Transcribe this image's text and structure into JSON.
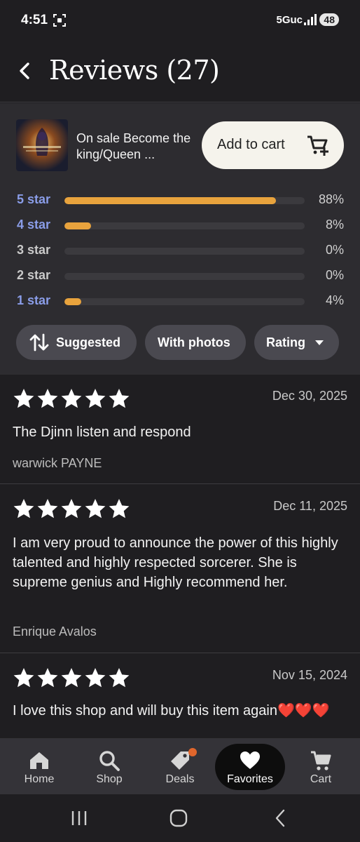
{
  "status": {
    "time": "4:51",
    "network": "5Guc",
    "battery": "48"
  },
  "header": {
    "title": "Reviews (27)",
    "back_icon": "chevron-left-icon"
  },
  "product": {
    "title": "On sale Become the king/Queen ...",
    "cart_button": "Add to cart",
    "cart_icon": "cart-plus-icon"
  },
  "ratings": [
    {
      "label": "5 star",
      "percent": "88%",
      "fraction": 0.88,
      "style": "link"
    },
    {
      "label": "4 star",
      "percent": "8%",
      "fraction": 0.11,
      "style": "link"
    },
    {
      "label": "3 star",
      "percent": "0%",
      "fraction": 0,
      "style": "plain"
    },
    {
      "label": "2 star",
      "percent": "0%",
      "fraction": 0,
      "style": "plain"
    },
    {
      "label": "1 star",
      "percent": "4%",
      "fraction": 0.07,
      "style": "link"
    }
  ],
  "filters": {
    "suggested": "Suggested",
    "with_photos": "With photos",
    "rating": "Rating"
  },
  "reviews": [
    {
      "stars": 5,
      "date": "Dec 30, 2025",
      "text": "The Djinn listen and respond",
      "author": "warwick PAYNE"
    },
    {
      "stars": 5,
      "date": "Dec 11, 2025",
      "text": "I am very proud to announce the power of this highly talented and highly respected sorcerer. She is supreme genius and Highly recommend her.",
      "author": "Enrique Avalos"
    },
    {
      "stars": 5,
      "date": "Nov 15, 2024",
      "text": "I love this shop and will buy this item again❤️❤️❤️",
      "author": ""
    }
  ],
  "nav": {
    "home": "Home",
    "shop": "Shop",
    "deals": "Deals",
    "favorites": "Favorites",
    "cart": "Cart"
  },
  "colors": {
    "background": "#1f1e21",
    "panel": "#2d2c30",
    "bar_fill": "#e8a33d",
    "link_label": "#8a9de8",
    "deals_badge": "#e0662c"
  }
}
